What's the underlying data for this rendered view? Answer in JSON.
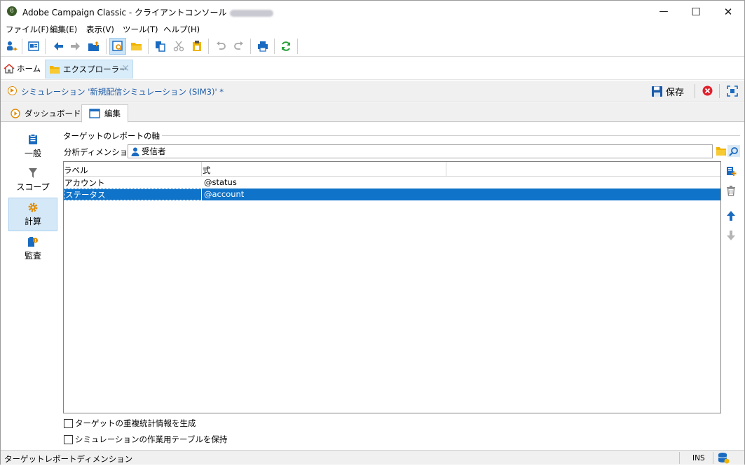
{
  "window": {
    "title": "Adobe Campaign Classic - クライアントコンソール",
    "min_glyph": "—",
    "max_glyph": "☐",
    "close_glyph": "✕"
  },
  "menubar": {
    "items": [
      "ファイル(F)",
      "編集(E)",
      "表示(V)",
      "ツール(T)",
      "ヘルプ(H)"
    ]
  },
  "nav": {
    "home_label": "ホーム",
    "explorer_label": "エクスプローラー"
  },
  "context": {
    "title": "シミュレーション '新規配信シミュレーション (SIM3)' *",
    "save_label": "保存"
  },
  "tabs": [
    {
      "label": "ダッシュボード",
      "active": false
    },
    {
      "label": "編集",
      "active": true
    }
  ],
  "left_nav": [
    {
      "label": "一般",
      "icon": "clipboard-icon",
      "active": false
    },
    {
      "label": "スコープ",
      "icon": "filter-icon",
      "active": false
    },
    {
      "label": "計算",
      "icon": "gear-icon",
      "active": true
    },
    {
      "label": "監査",
      "icon": "audit-icon",
      "active": false
    }
  ],
  "section": {
    "group_title": "ターゲットのレポートの軸",
    "dimension_label": "分析ディメンション:",
    "dimension_value": "受信者"
  },
  "grid": {
    "columns": [
      "ラベル",
      "式"
    ],
    "rows": [
      {
        "label": "アカウント",
        "expr": "@status",
        "selected": false
      },
      {
        "label": "ステータス",
        "expr": "@account",
        "selected": true
      }
    ]
  },
  "options": [
    {
      "label": "ターゲットの重複統計情報を生成",
      "checked": false
    },
    {
      "label": "シミュレーションの作業用テーブルを保持",
      "checked": false
    }
  ],
  "status": {
    "text": "ターゲットレポートディメンション",
    "mode": "INS"
  },
  "colors": {
    "accent": "#0f73c9",
    "link": "#1a5aa8",
    "orange": "#e08a00",
    "folder": "#f0b400",
    "stop": "#e0202c",
    "green": "#27a03a"
  }
}
